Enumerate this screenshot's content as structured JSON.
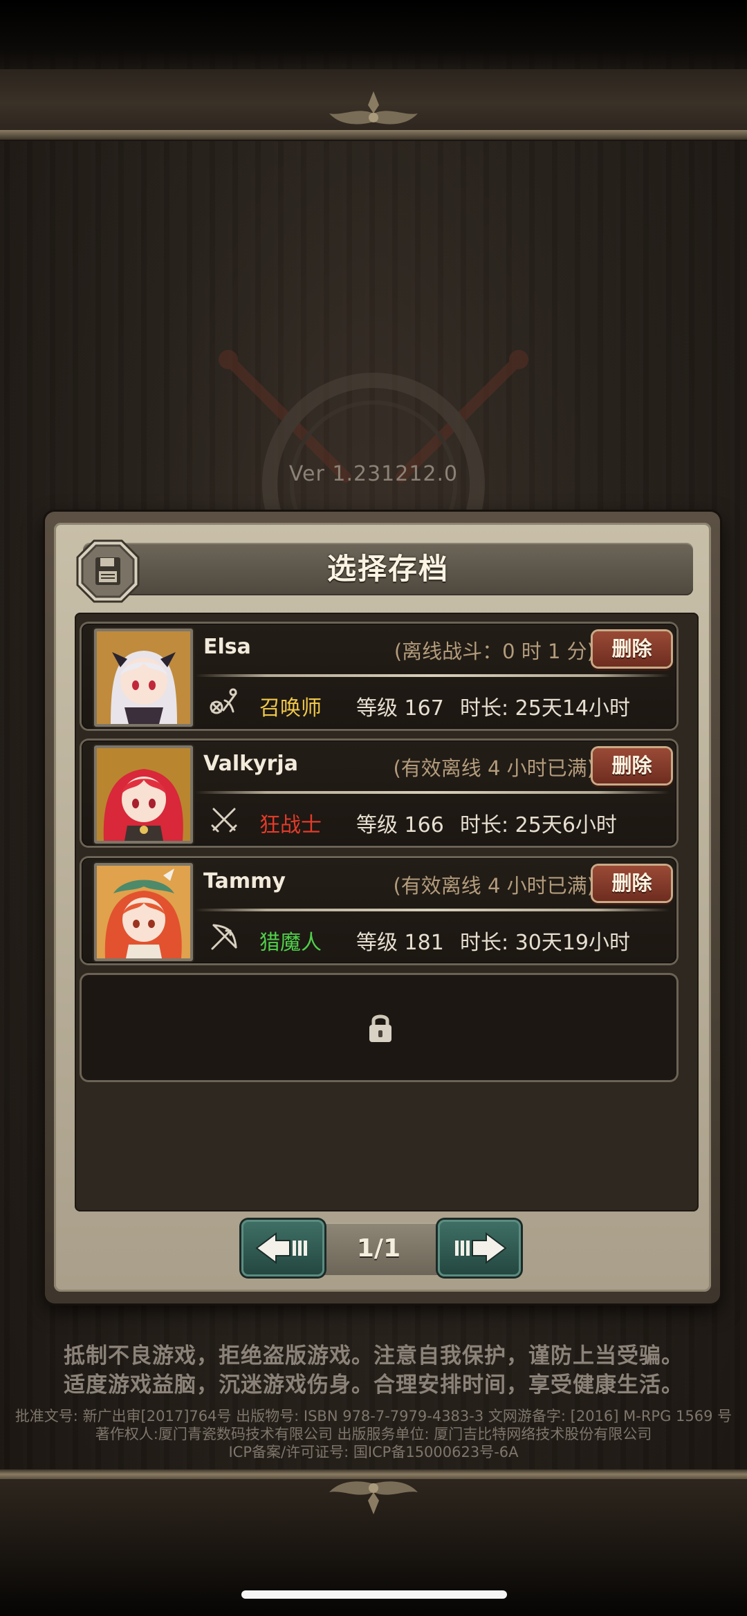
{
  "version": "Ver 1.231212.0",
  "dialog": {
    "title": "选择存档"
  },
  "saves": [
    {
      "name": "Elsa",
      "status": "(离线战斗：0 时 1 分)",
      "delete_label": "删除",
      "class_name": "召唤师",
      "class_color": "#f0c84a",
      "class_icon": "summoner-icon",
      "level": "等级 167",
      "playtime": "时长: 25天14小时"
    },
    {
      "name": "Valkyrja",
      "status": "(有效离线 4 小时已满)",
      "delete_label": "删除",
      "class_name": "狂战士",
      "class_color": "#e33b2a",
      "class_icon": "crossed-swords-icon",
      "level": "等级 166",
      "playtime": "时长: 25天6小时"
    },
    {
      "name": "Tammy",
      "status": "(有效离线 4 小时已满)",
      "delete_label": "删除",
      "class_name": "猎魔人",
      "class_color": "#4fcf4a",
      "class_icon": "bow-icon",
      "level": "等级 181",
      "playtime": "时长: 30天19小时"
    }
  ],
  "pager": {
    "page": "1/1"
  },
  "notices": [
    "抵制不良游戏，拒绝盗版游戏。注意自我保护，谨防上当受骗。",
    "适度游戏益脑，沉迷游戏伤身。合理安排时间，享受健康生活。"
  ],
  "legal": [
    "批准文号: 新广出审[2017]764号 出版物号: ISBN 978-7-7979-4383-3 文网游备字: [2016] M-RPG 1569 号",
    "著作权人:厦门青瓷数码技术有限公司 出版服务单位: 厦门吉比特网络技术股份有限公司",
    "ICP备案/许可证号: 国ICP备15000623号-6A"
  ],
  "colors": {
    "delete_button": "#8a3e2c",
    "pager_button": "#2f5a52",
    "status_text": "#b39c7c"
  }
}
